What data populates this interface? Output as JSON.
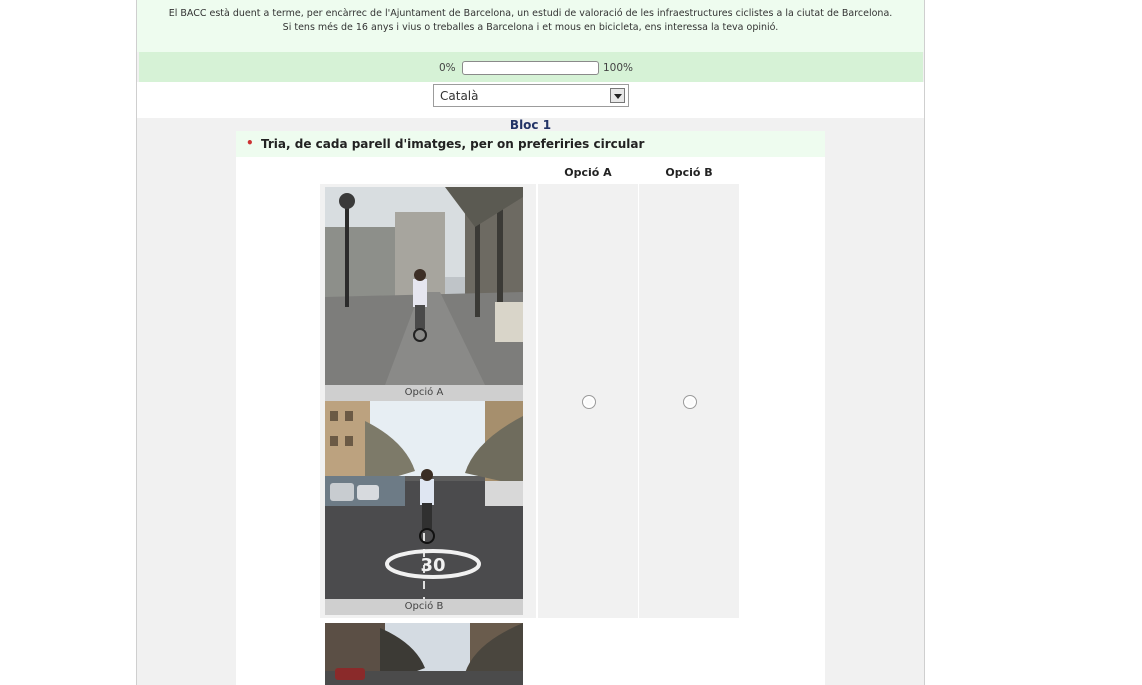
{
  "intro": {
    "line1": "El BACC està duent a terme, per encàrrec de l'Ajuntament de Barcelona, un estudi de valoració de les infraestructures ciclistes a la ciutat de Barcelona.",
    "line2": "Si tens més de 16 anys i vius o treballes a Barcelona i et mous en bicicleta, ens interessa la teva opinió."
  },
  "progress": {
    "min_label": "0%",
    "max_label": "100%",
    "value_percent": 0
  },
  "language": {
    "selected": "Català"
  },
  "block": {
    "title": "Bloc 1",
    "question": "Tria, de cada parell d'imatges, per on preferiries circular",
    "columns": [
      "Opció A",
      "Opció B"
    ],
    "pair": {
      "caption_a": "Opció A",
      "caption_b": "Opció B"
    }
  },
  "colors": {
    "accent_green": "#d6f2d6",
    "light_green": "#eefcef",
    "title_blue": "#223366",
    "bullet_red": "#cc3333"
  }
}
